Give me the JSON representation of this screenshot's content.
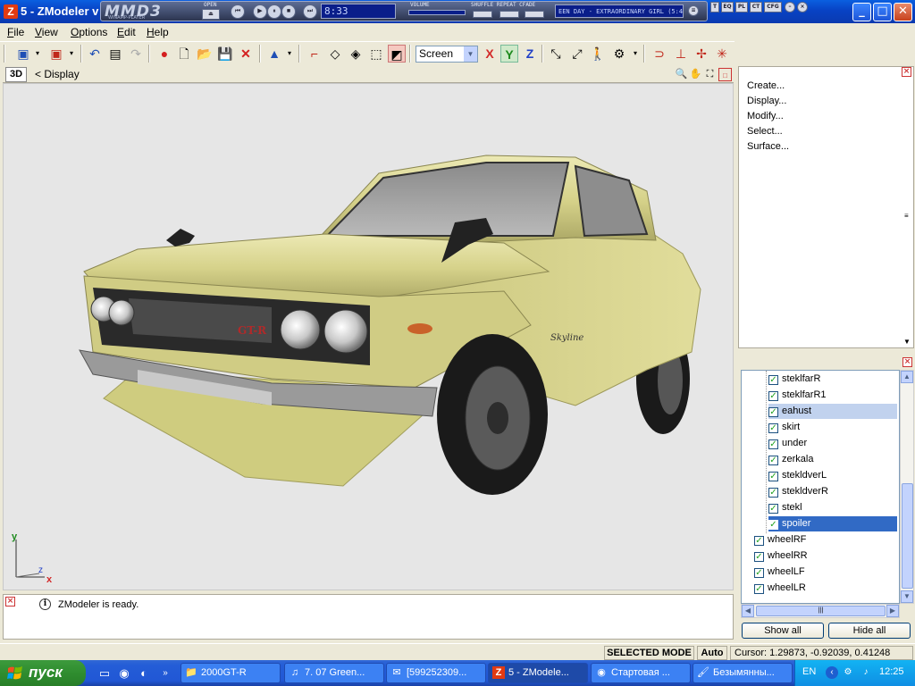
{
  "window": {
    "title": "5 - ZModeler v",
    "app_icon_letter": "Z",
    "controls": {
      "minimize": "_",
      "maximize": "□",
      "close": "✕"
    }
  },
  "winamp": {
    "logo": "MMD3",
    "subtitle": "WINAMP-PLAYER",
    "open_label": "OPEN",
    "volume_label": "VOLUME",
    "modes_label": "SHUFFLE REPEAT CFADE",
    "time": "8:33",
    "song": "EEN DAY - EXTRAORDINARY GIRL (5:4",
    "mini_buttons": [
      "T",
      "EQ",
      "PL",
      "CT",
      "CFG"
    ]
  },
  "menu": [
    {
      "label": "File",
      "key": "F",
      "rest": "ile"
    },
    {
      "label": "View",
      "key": "V",
      "rest": "iew"
    },
    {
      "label": "Options",
      "key": "O",
      "rest": "ptions"
    },
    {
      "label": "Edit",
      "key": "E",
      "rest": "dit"
    },
    {
      "label": "Help",
      "key": "H",
      "rest": "elp"
    }
  ],
  "toolbar": {
    "view_select": "Screen",
    "axes": [
      "X",
      "Y",
      "Z"
    ],
    "colors": {
      "x": "#d32a2a",
      "y": "#1d8a1d",
      "z": "#2241c7"
    }
  },
  "viewport": {
    "mode": "3D",
    "display_label": "<  Display",
    "background": "#e6e6e6",
    "car_color": "#d9d58a",
    "axis_labels": {
      "y": "y",
      "z": "z",
      "x": "x"
    }
  },
  "log": {
    "message": "ZModeler is ready."
  },
  "commands": [
    "Create...",
    "Display...",
    "Modify...",
    "Select...",
    "Surface..."
  ],
  "tree": {
    "items": [
      {
        "label": "steklfarR",
        "checked": true,
        "level": 2,
        "state": ""
      },
      {
        "label": "steklfarR1",
        "checked": true,
        "level": 2,
        "state": ""
      },
      {
        "label": "eahust",
        "checked": true,
        "level": 2,
        "state": "light"
      },
      {
        "label": "skirt",
        "checked": true,
        "level": 2,
        "state": ""
      },
      {
        "label": "under",
        "checked": true,
        "level": 2,
        "state": ""
      },
      {
        "label": "zerkala",
        "checked": true,
        "level": 2,
        "state": ""
      },
      {
        "label": "stekldverL",
        "checked": true,
        "level": 2,
        "state": ""
      },
      {
        "label": "stekldverR",
        "checked": true,
        "level": 2,
        "state": ""
      },
      {
        "label": "stekl",
        "checked": true,
        "level": 2,
        "state": ""
      },
      {
        "label": "spoiler",
        "checked": true,
        "level": 2,
        "state": "dark"
      },
      {
        "label": "wheelRF",
        "checked": true,
        "level": 1,
        "state": ""
      },
      {
        "label": "wheelRR",
        "checked": true,
        "level": 1,
        "state": ""
      },
      {
        "label": "wheelLF",
        "checked": true,
        "level": 1,
        "state": ""
      },
      {
        "label": "wheelLR",
        "checked": true,
        "level": 1,
        "state": ""
      }
    ],
    "show_all": "Show all",
    "hide_all": "Hide all"
  },
  "status": {
    "mode": "SELECTED MODE",
    "auto": "Auto",
    "cursor": "Cursor: 1.29873, -0.92039, 0.41248"
  },
  "taskbar": {
    "start": "пуск",
    "tasks": [
      {
        "label": "2000GT-R",
        "icon": "folder-icon",
        "active": false
      },
      {
        "label": "7. 07 Green...",
        "icon": "music-icon",
        "active": false
      },
      {
        "label": "[599252309...",
        "icon": "chat-icon",
        "active": false
      },
      {
        "label": "5 - ZModele...",
        "icon": "zmodeler-icon",
        "active": true
      },
      {
        "label": "Стартовая ...",
        "icon": "firefox-icon",
        "active": false
      },
      {
        "label": "Безымянны...",
        "icon": "paint-icon",
        "active": false
      }
    ],
    "language": "EN",
    "clock": "12:25"
  }
}
